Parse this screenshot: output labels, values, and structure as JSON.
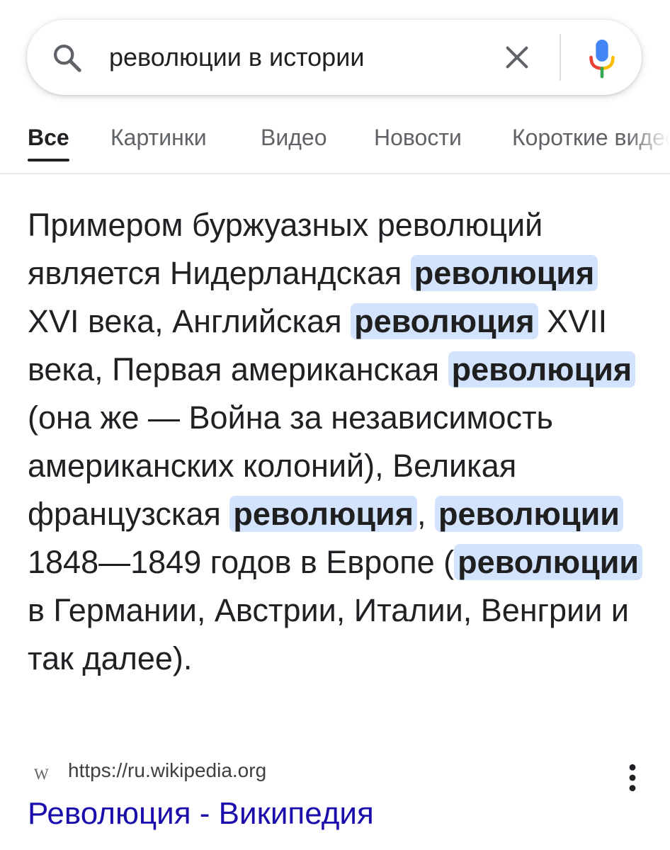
{
  "search": {
    "query": "революции в истории"
  },
  "icons": {
    "search": "search-icon",
    "clear": "close-icon",
    "mic": "microphone-icon",
    "more": "more-vert-icon",
    "favicon": "wikipedia-favicon"
  },
  "tabs": [
    {
      "label": "Все",
      "active": true
    },
    {
      "label": "Картинки",
      "active": false
    },
    {
      "label": "Видео",
      "active": false
    },
    {
      "label": "Новости",
      "active": false
    },
    {
      "label": "Короткие видео",
      "active": false
    }
  ],
  "snippet": {
    "t1": "Примером буржуазных революций является Нидерландская ",
    "h1": "революция",
    "t2": " XVI века, Английская ",
    "h2": "революция",
    "t3": " XVII века, Первая американская ",
    "h3": "революция",
    "t4": " (она же — Война за независимость американских колоний), Великая французская ",
    "h4": "революция",
    "t5": ", ",
    "h5": "революции",
    "t6": " 1848—1849 годов в Европе (",
    "h6": "революции",
    "t7": " в Германии, Австрии, Италии, Венгрии и так далее)."
  },
  "result": {
    "favicon_letter": "W",
    "url": "https://ru.wikipedia.org",
    "title": "Революция - Википедия"
  },
  "colors": {
    "highlight": "#d3e3fd",
    "link": "#1a0dab",
    "text": "#202124",
    "secondary": "#5f6368"
  }
}
